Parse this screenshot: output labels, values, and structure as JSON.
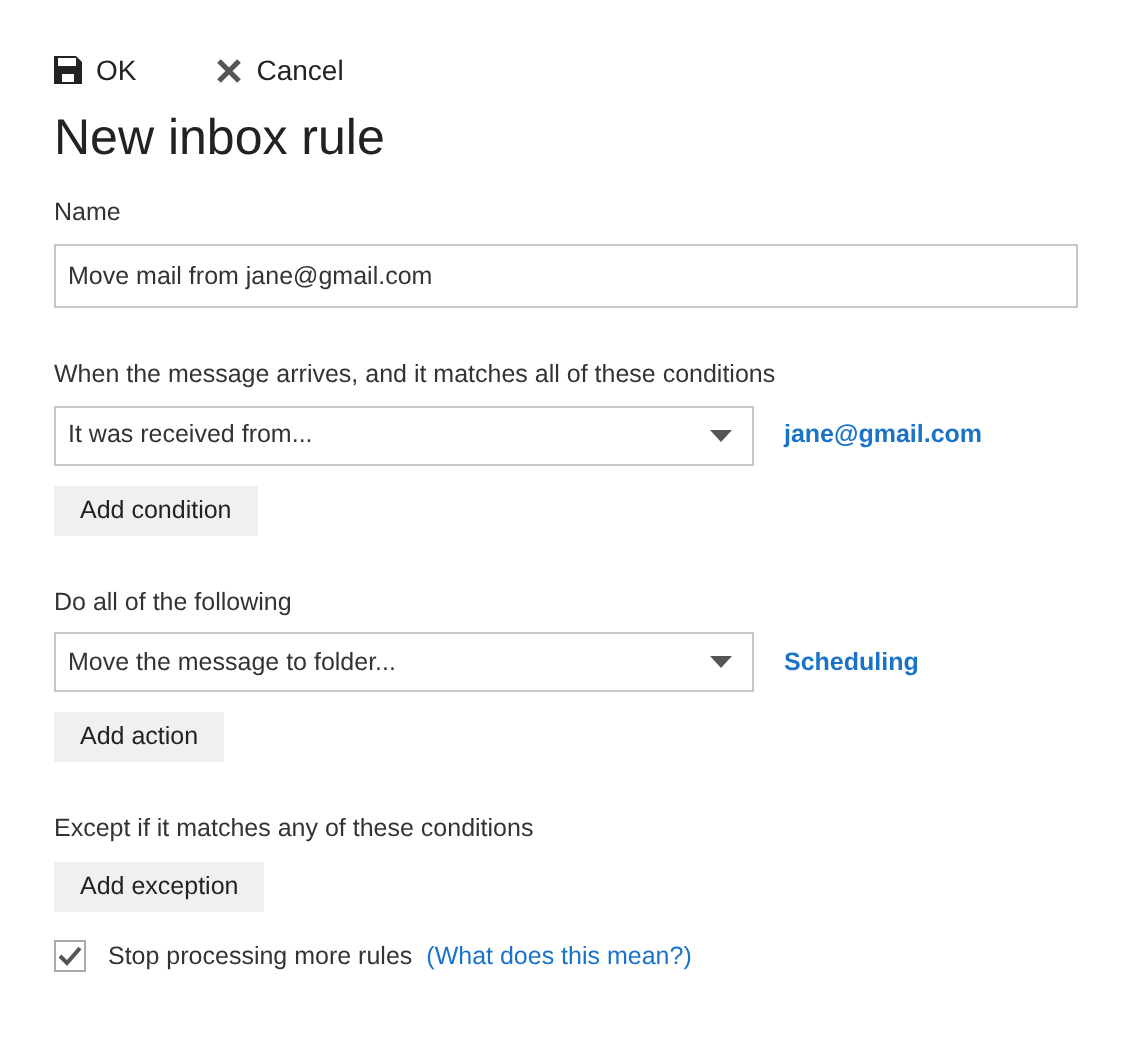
{
  "toolbar": [
    {
      "kind": "save",
      "label": "OK"
    },
    {
      "kind": "cancel",
      "label": "Cancel"
    }
  ],
  "title": "New inbox rule",
  "name_field": {
    "label": "Name",
    "value": "Move mail from jane@gmail.com"
  },
  "sections": [
    {
      "label": "When the message arrives, and it matches all of these conditions",
      "dropdown": "It was received from...",
      "link": "jane@gmail.com",
      "button": "Add condition"
    },
    {
      "label": "Do all of the following",
      "dropdown": "Move the message to folder...",
      "link": "Scheduling",
      "button": "Add action"
    },
    {
      "label": "Except if it matches any of these conditions",
      "button": "Add exception"
    }
  ],
  "stop_processing": {
    "label": "Stop processing more rules",
    "checked": true,
    "help_link": "(What does this mean?)"
  }
}
